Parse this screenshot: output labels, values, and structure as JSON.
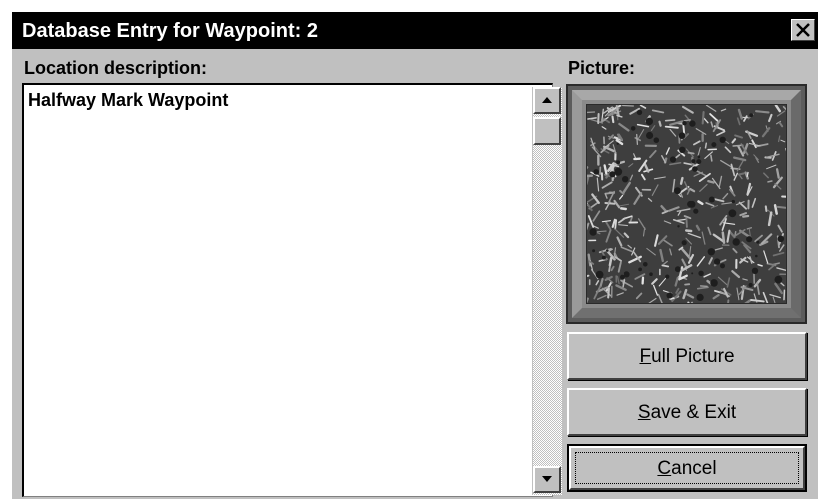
{
  "window": {
    "title": "Database Entry for Waypoint: 2",
    "close_icon": "close-icon"
  },
  "location": {
    "label": "Location description:",
    "text": "Halfway Mark Waypoint"
  },
  "picture": {
    "label": "Picture:",
    "content": "fern foliage photograph (grayscale)"
  },
  "buttons": {
    "full_picture": {
      "mnemonic": "F",
      "rest": "ull Picture"
    },
    "save_exit": {
      "mnemonic": "S",
      "rest": "ave & Exit"
    },
    "cancel": {
      "mnemonic": "C",
      "rest": "ancel"
    }
  },
  "colors": {
    "titlebar": "#000000",
    "title_text": "#ffffff",
    "dialog_face": "#c0c0c0",
    "text_bg": "#ffffff"
  }
}
